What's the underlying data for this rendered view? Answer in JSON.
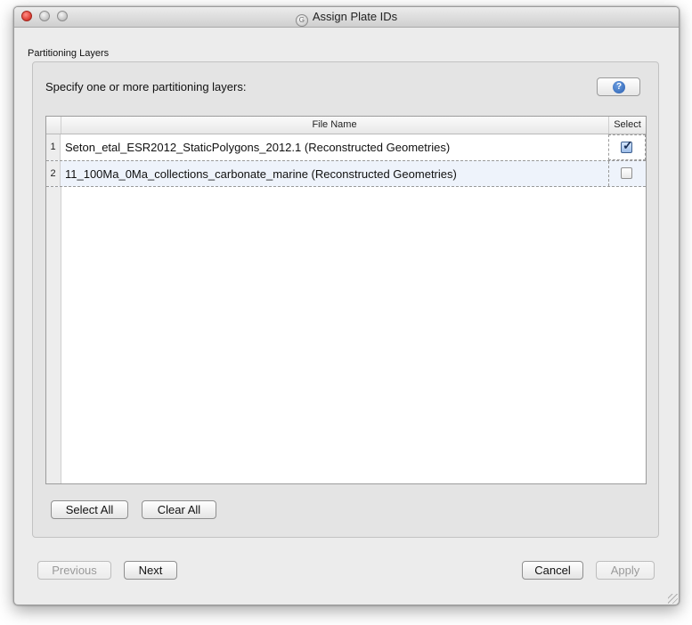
{
  "window": {
    "title": "Assign Plate IDs",
    "app_icon": "gplates-icon"
  },
  "group": {
    "label": "Partitioning Layers",
    "instruction": "Specify one or more partitioning layers:",
    "help_icon": "help-icon",
    "help_glyph": "?"
  },
  "table": {
    "columns": [
      "File Name",
      "Select"
    ],
    "rows": [
      {
        "num": "1",
        "name": "Seton_etal_ESR2012_StaticPolygons_2012.1 (Reconstructed Geometries)",
        "selected": true
      },
      {
        "num": "2",
        "name": "11_100Ma_0Ma_collections_carbonate_marine (Reconstructed Geometries)",
        "selected": false
      }
    ]
  },
  "actions": {
    "select_all": "Select All",
    "clear_all": "Clear All"
  },
  "footer": {
    "previous": "Previous",
    "next": "Next",
    "cancel": "Cancel",
    "apply": "Apply"
  },
  "colors": {
    "accent": "#2a5fb0",
    "close": "#e0443a",
    "selected_row": "#eef3fb"
  }
}
